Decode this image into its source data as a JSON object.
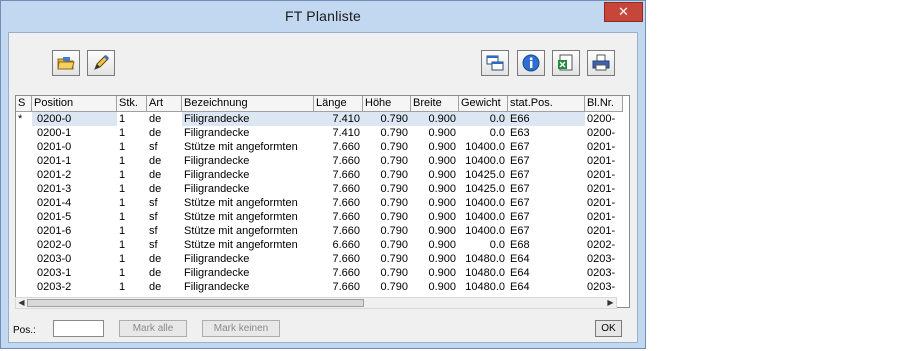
{
  "window": {
    "title": "FT Planliste",
    "close_glyph": "✕"
  },
  "toolbar": {
    "left_buttons": [
      {
        "name": "open-folder-icon"
      },
      {
        "name": "edit-pencil-icon"
      }
    ],
    "right_buttons": [
      {
        "name": "windows-layout-icon"
      },
      {
        "name": "info-icon"
      },
      {
        "name": "excel-export-icon"
      },
      {
        "name": "print-icon"
      }
    ]
  },
  "table": {
    "columns": [
      "S",
      "Position",
      "Stk.",
      "Art",
      "Bezeichnung",
      "Länge",
      "Höhe",
      "Breite",
      "Gewicht",
      "stat.Pos.",
      "Bl.Nr."
    ],
    "rows": [
      [
        "*",
        "0200-0",
        "1",
        "de",
        "Filigrandecke",
        "7.410",
        "0.790",
        "0.900",
        "0.0",
        "E66",
        "0200-"
      ],
      [
        "",
        "0200-1",
        "1",
        "de",
        "Filigrandecke",
        "7.410",
        "0.790",
        "0.900",
        "0.0",
        "E63",
        "0200-"
      ],
      [
        "",
        "0201-0",
        "1",
        "sf",
        "Stütze mit angeformten",
        "7.660",
        "0.790",
        "0.900",
        "10400.0",
        "E67",
        "0201-"
      ],
      [
        "",
        "0201-1",
        "1",
        "de",
        "Filigrandecke",
        "7.660",
        "0.790",
        "0.900",
        "10400.0",
        "E67",
        "0201-"
      ],
      [
        "",
        "0201-2",
        "1",
        "de",
        "Filigrandecke",
        "7.660",
        "0.790",
        "0.900",
        "10425.0",
        "E67",
        "0201-"
      ],
      [
        "",
        "0201-3",
        "1",
        "de",
        "Filigrandecke",
        "7.660",
        "0.790",
        "0.900",
        "10425.0",
        "E67",
        "0201-"
      ],
      [
        "",
        "0201-4",
        "1",
        "sf",
        "Stütze mit angeformten",
        "7.660",
        "0.790",
        "0.900",
        "10400.0",
        "E67",
        "0201-"
      ],
      [
        "",
        "0201-5",
        "1",
        "sf",
        "Stütze mit angeformten",
        "7.660",
        "0.790",
        "0.900",
        "10400.0",
        "E67",
        "0201-"
      ],
      [
        "",
        "0201-6",
        "1",
        "sf",
        "Stütze mit angeformten",
        "7.660",
        "0.790",
        "0.900",
        "10400.0",
        "E67",
        "0201-"
      ],
      [
        "",
        "0202-0",
        "1",
        "sf",
        "Stütze mit angeformten",
        "6.660",
        "0.790",
        "0.900",
        "0.0",
        "E68",
        "0202-"
      ],
      [
        "",
        "0203-0",
        "1",
        "de",
        "Filigrandecke",
        "7.660",
        "0.790",
        "0.900",
        "10480.0",
        "E64",
        "0203-"
      ],
      [
        "",
        "0203-1",
        "1",
        "de",
        "Filigrandecke",
        "7.660",
        "0.790",
        "0.900",
        "10480.0",
        "E64",
        "0203-"
      ],
      [
        "",
        "0203-2",
        "1",
        "de",
        "Filigrandecke",
        "7.660",
        "0.790",
        "0.900",
        "10480.0",
        "E64",
        "0203-"
      ]
    ],
    "selected_row": 0
  },
  "footer": {
    "pos_label": "Pos.:",
    "pos_value": "",
    "mark_all_label": "Mark alle",
    "mark_none_label": "Mark keinen",
    "ok_label": "OK"
  }
}
